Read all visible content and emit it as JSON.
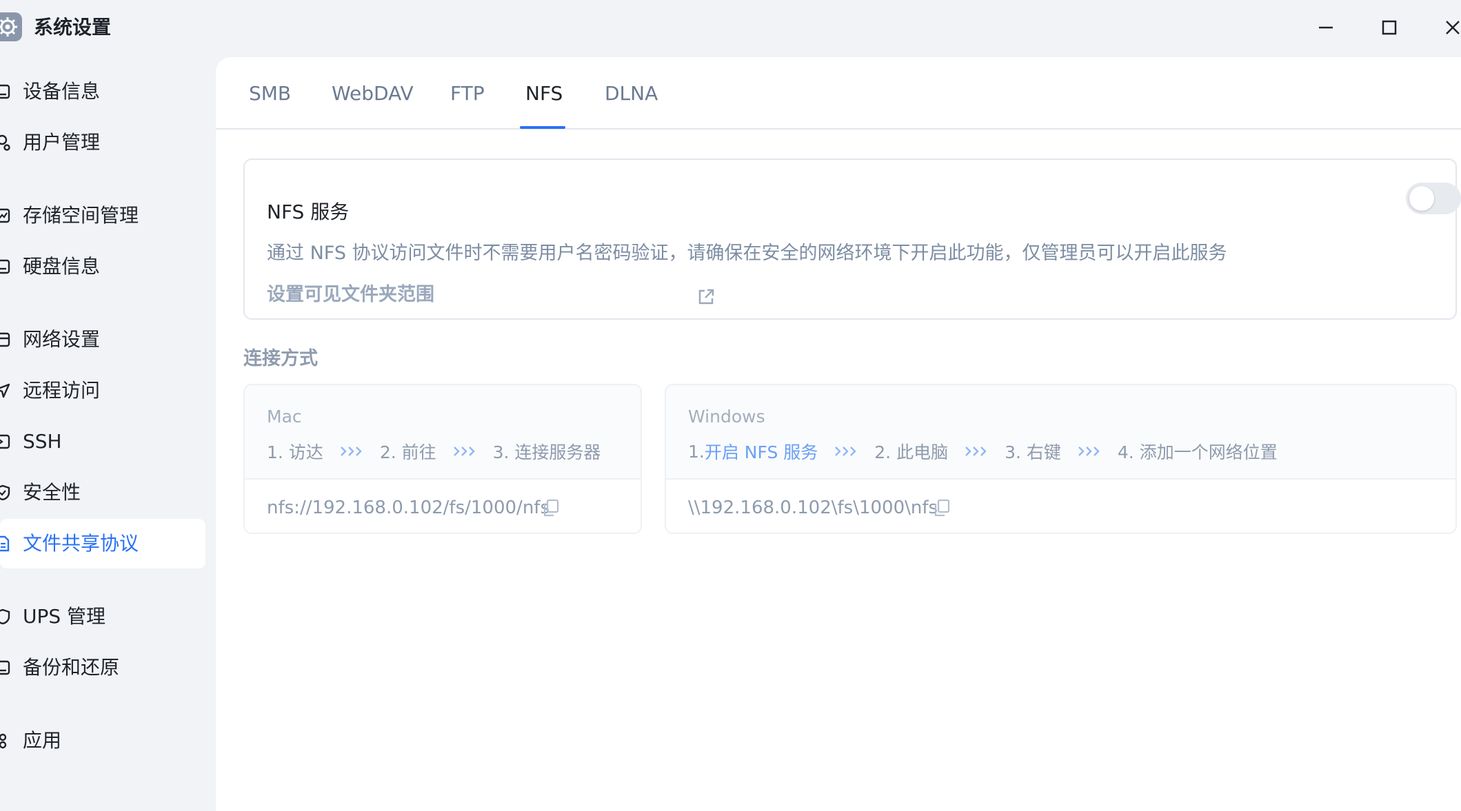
{
  "window": {
    "title": "系统设置",
    "icons": {
      "app": "gear-icon",
      "minimize": "minimize-icon",
      "maximize": "maximize-icon",
      "close": "close-icon"
    }
  },
  "sidebar": {
    "items": [
      {
        "label": "设备信息",
        "icon": "device-icon",
        "active": false
      },
      {
        "label": "用户管理",
        "icon": "users-icon",
        "active": false
      },
      {
        "label": "存储空间管理",
        "icon": "storage-icon",
        "active": false
      },
      {
        "label": "硬盘信息",
        "icon": "disk-icon",
        "active": false
      },
      {
        "label": "网络设置",
        "icon": "network-icon",
        "active": false
      },
      {
        "label": "远程访问",
        "icon": "remote-icon",
        "active": false
      },
      {
        "label": "SSH",
        "icon": "terminal-icon",
        "active": false
      },
      {
        "label": "安全性",
        "icon": "shield-icon",
        "active": false
      },
      {
        "label": "文件共享协议",
        "icon": "file-share-icon",
        "active": true
      },
      {
        "label": "UPS 管理",
        "icon": "ups-icon",
        "active": false
      },
      {
        "label": "备份和还原",
        "icon": "backup-icon",
        "active": false
      },
      {
        "label": "应用",
        "icon": "apps-icon",
        "active": false
      }
    ]
  },
  "tabs": [
    {
      "label": "SMB",
      "active": false
    },
    {
      "label": "WebDAV",
      "active": false
    },
    {
      "label": "FTP",
      "active": false
    },
    {
      "label": "NFS",
      "active": true
    },
    {
      "label": "DLNA",
      "active": false
    }
  ],
  "nfs_card": {
    "title": "NFS 服务",
    "description": "通过 NFS 协议访问文件时不需要用户名密码验证，请确保在安全的网络环境下开启此功能，仅管理员可以开启此服务",
    "link": "设置可见文件夹范围",
    "enabled": false
  },
  "connection": {
    "label": "连接方式",
    "mac": {
      "os": "Mac",
      "steps": [
        "1. 访达",
        "2. 前往",
        "3. 连接服务器"
      ],
      "path": "nfs://192.168.0.102/fs/1000/nfs"
    },
    "windows": {
      "os": "Windows",
      "step1_prefix": "1. ",
      "step1_link": "开启 NFS 服务",
      "steps": [
        "2. 此电脑",
        "3. 右键",
        "4. 添加一个网络位置"
      ],
      "path": "\\\\192.168.0.102\\fs\\1000\\nfs"
    }
  },
  "colors": {
    "accent": "#2a72f5",
    "link": "#6aa0f5",
    "muted": "#8e9bad"
  }
}
